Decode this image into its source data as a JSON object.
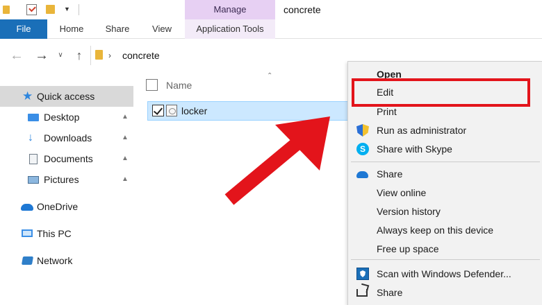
{
  "window": {
    "title": "concrete",
    "contextual_group": "Manage"
  },
  "ribbon": {
    "tabs": [
      {
        "label": "File"
      },
      {
        "label": "Home"
      },
      {
        "label": "Share"
      },
      {
        "label": "View"
      },
      {
        "label": "Application Tools"
      }
    ]
  },
  "address_bar": {
    "path": [
      "concrete"
    ]
  },
  "sidebar": {
    "items": [
      {
        "label": "Quick access",
        "icon": "star-icon"
      },
      {
        "label": "Desktop",
        "icon": "desktop-icon",
        "pinned": true
      },
      {
        "label": "Downloads",
        "icon": "download-icon",
        "pinned": true
      },
      {
        "label": "Documents",
        "icon": "documents-icon",
        "pinned": true
      },
      {
        "label": "Pictures",
        "icon": "pictures-icon",
        "pinned": true
      },
      {
        "label": "OneDrive",
        "icon": "onedrive-icon"
      },
      {
        "label": "This PC",
        "icon": "this-pc-icon"
      },
      {
        "label": "Network",
        "icon": "network-icon"
      }
    ]
  },
  "file_list": {
    "column_header": "Name",
    "rows": [
      {
        "name": "locker",
        "selected": true,
        "checked": true
      }
    ]
  },
  "context_menu": {
    "items": [
      {
        "label": "Open",
        "bold": true
      },
      {
        "label": "Edit",
        "highlighted": true
      },
      {
        "label": "Print"
      },
      {
        "label": "Run as administrator",
        "icon": "uac-shield-icon"
      },
      {
        "label": "Share with Skype",
        "icon": "skype-icon"
      },
      {
        "label": "Share",
        "icon": "onedrive-cloud-icon"
      },
      {
        "label": "View online"
      },
      {
        "label": "Version history"
      },
      {
        "label": "Always keep on this device"
      },
      {
        "label": "Free up space"
      },
      {
        "label": "Scan with Windows Defender...",
        "icon": "windows-defender-icon"
      },
      {
        "label": "Share",
        "icon": "share-icon"
      }
    ]
  },
  "colors": {
    "file_tab": "#1a6fb8",
    "manage_tab": "#e7d0f3",
    "selection": "#cce8ff",
    "annotation_red": "#e3141b"
  }
}
